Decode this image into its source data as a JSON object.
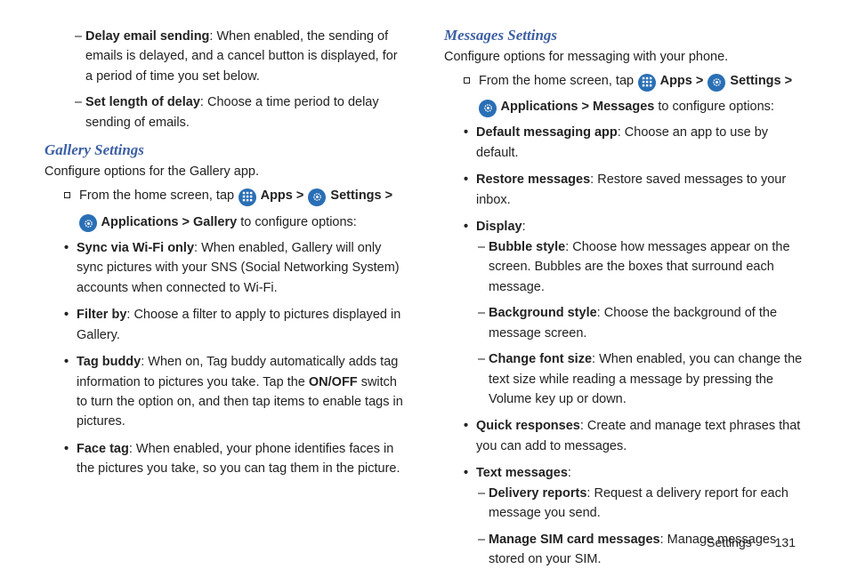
{
  "leftCol": {
    "preDash": [
      {
        "boldLabel": "Delay email sending",
        "rest": ": When enabled, the sending of emails is delayed, and a cancel button is displayed, for a period of time you set below."
      },
      {
        "boldLabel": "Set length of delay",
        "rest": ": Choose a time period to delay sending of emails."
      }
    ],
    "heading": "Gallery Settings",
    "intro": "Configure options for the Gallery app.",
    "fromPrefix": "From the home screen, tap ",
    "appsLabel": " Apps > ",
    "settingsLabel": " Settings > ",
    "pathTail": " Applications > Gallery",
    "pathTailRest": " to configure options:",
    "bullets": [
      {
        "boldLabel": "Sync via Wi-Fi only",
        "rest": ": When enabled, Gallery will only sync pictures with your SNS (Social Networking System) accounts when connected to Wi-Fi."
      },
      {
        "boldLabel": "Filter by",
        "rest": ": Choose a filter to apply to pictures displayed in Gallery."
      },
      {
        "boldPre": "Tag buddy",
        "mid": ": When on, Tag buddy automatically adds tag information to pictures you take. Tap the ",
        "boldMid": "ON/OFF",
        "post": " switch to turn the option on, and then tap items to enable tags in pictures."
      },
      {
        "boldLabel": "Face tag",
        "rest": ": When enabled, your phone identifies faces in the pictures you take, so you can tag them in the picture."
      }
    ]
  },
  "rightCol": {
    "heading": "Messages Settings",
    "intro": "Configure options for messaging with your phone.",
    "fromPrefix": "From the home screen, tap ",
    "appsLabel": " Apps > ",
    "settingsLabel": " Settings > ",
    "pathTail": " Applications > Messages",
    "pathTailRest": " to configure options:",
    "bullets": [
      {
        "boldLabel": "Default messaging app",
        "rest": ": Choose an app to use by default."
      },
      {
        "boldLabel": "Restore messages",
        "rest": ": Restore  saved messages to your inbox."
      },
      {
        "boldLabel": "Display",
        "rest": ":",
        "sub": [
          {
            "boldLabel": "Bubble style",
            "rest": ": Choose how messages appear on the screen. Bubbles are the boxes that surround each message."
          },
          {
            "boldLabel": "Background style",
            "rest": ": Choose the background of the message screen."
          },
          {
            "boldLabel": "Change font size",
            "rest": ": When enabled, you can change the text size while reading a message by pressing the Volume key up or down."
          }
        ]
      },
      {
        "boldLabel": "Quick responses",
        "rest": ": Create and manage text phrases that you can add to messages."
      },
      {
        "boldLabel": "Text messages",
        "rest": ":",
        "sub": [
          {
            "boldLabel": "Delivery reports",
            "rest": ": Request a delivery report for each message you send."
          },
          {
            "boldLabel": "Manage SIM card messages",
            "rest": ": Manage messages stored on your SIM."
          }
        ]
      }
    ]
  },
  "footer": {
    "section": "Settings",
    "page": "131"
  }
}
